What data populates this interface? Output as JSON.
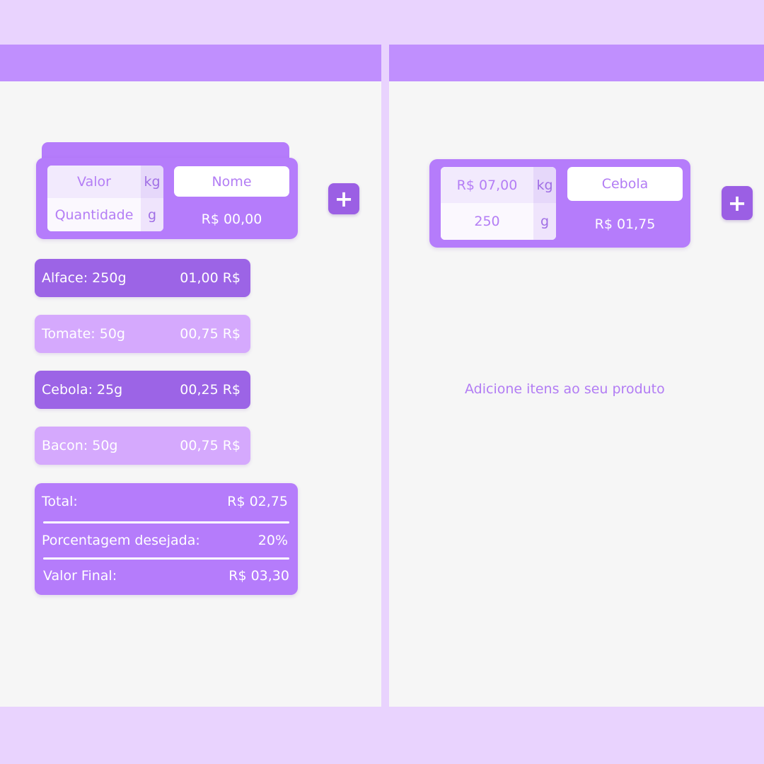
{
  "left_screen": {
    "calculator": {
      "value_placeholder": "Valor",
      "value_unit": "kg",
      "quantity_placeholder": "Quantidade",
      "quantity_unit": "g",
      "name_placeholder": "Nome",
      "price": "R$ 00,00"
    },
    "add_button": "+",
    "items": [
      {
        "label": "Alface: 250g",
        "price": "01,00 R$",
        "style": "dark"
      },
      {
        "label": "Tomate: 50g",
        "price": "00,75 R$",
        "style": "light"
      },
      {
        "label": "Cebola: 25g",
        "price": "00,25 R$",
        "style": "dark"
      },
      {
        "label": "Bacon: 50g",
        "price": "00,75 R$",
        "style": "light"
      }
    ],
    "summary": {
      "total_label": "Total:",
      "total_value": "R$ 02,75",
      "percent_label": "Porcentagem desejada:",
      "percent_value": "20%",
      "final_label": "Valor Final:",
      "final_value": "R$ 03,30"
    }
  },
  "right_screen": {
    "calculator": {
      "value": "R$ 07,00",
      "value_unit": "kg",
      "quantity": "250",
      "quantity_unit": "g",
      "name": "Cebola",
      "price": "R$ 01,75"
    },
    "add_button": "+",
    "empty_message": "Adicione itens ao seu produto"
  }
}
